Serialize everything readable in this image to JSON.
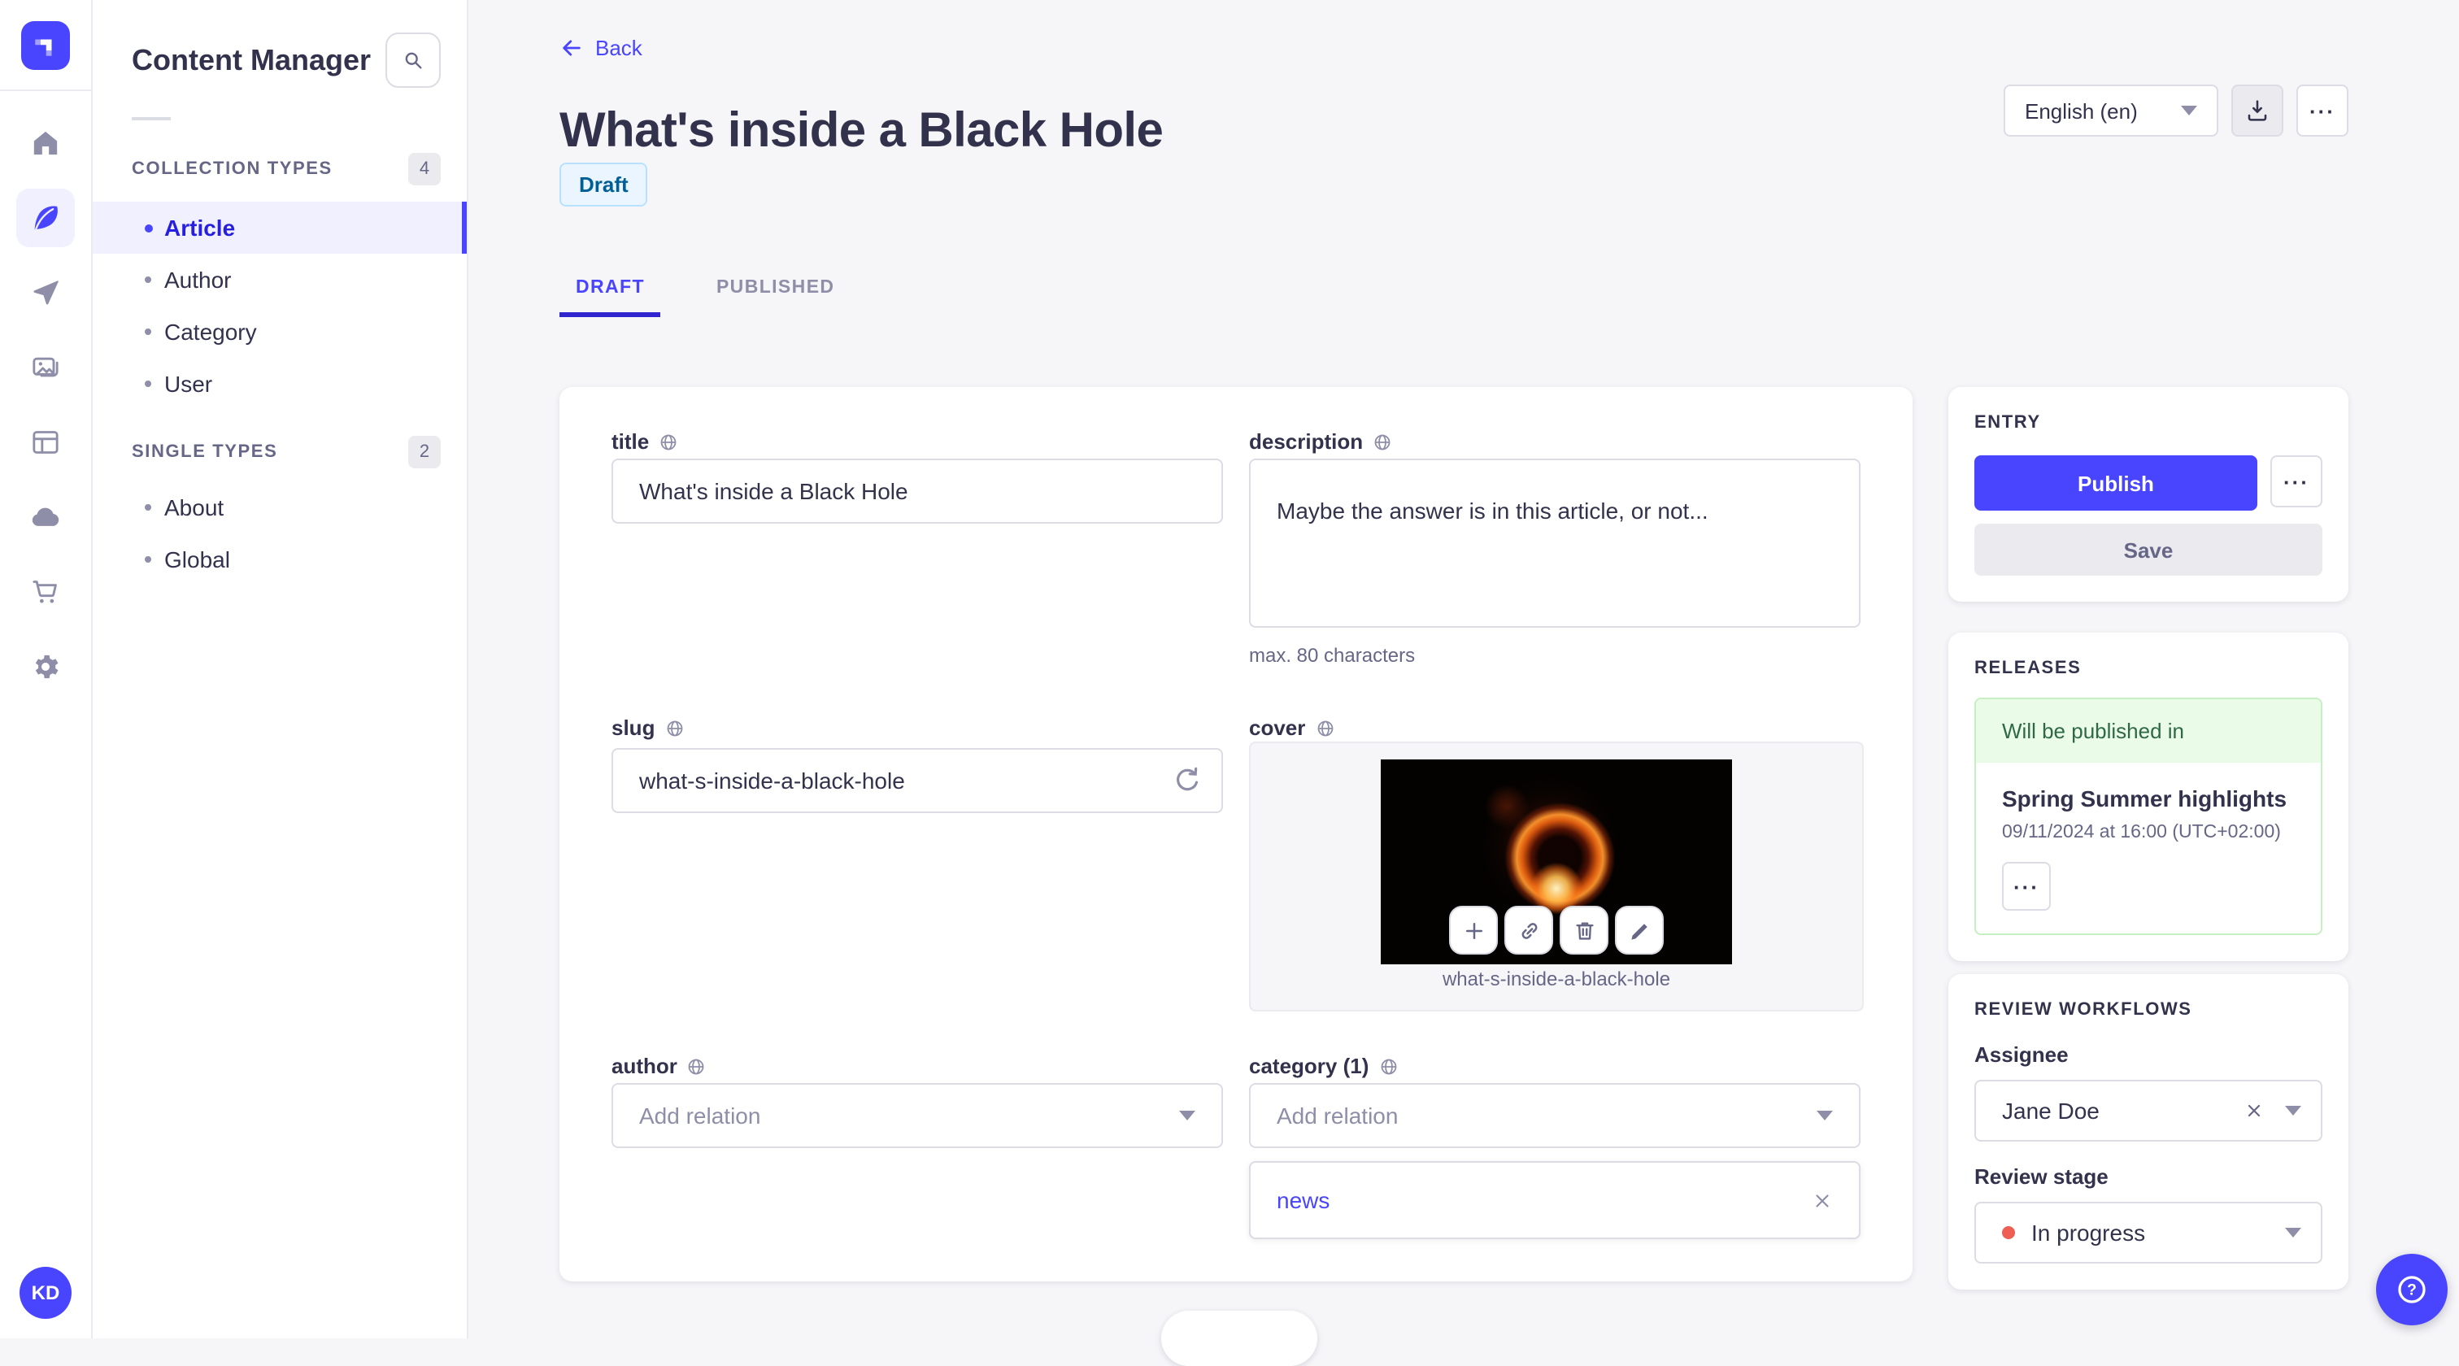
{
  "colors": {
    "accent": "#4945ff",
    "accent_dark": "#271fe0",
    "accent_light": "#f0f0ff",
    "text_dark": "#32324d",
    "text_grey": "#666687",
    "border": "#dcdce4",
    "draft_bg": "#eaf5ff",
    "draft_border": "#b8e1ff",
    "draft_text": "#006096",
    "success_bg": "#eafbe7",
    "success_border": "#c6f0c2",
    "success_text": "#2f6846",
    "danger_dot": "#ee5e52"
  },
  "ui": {
    "ellipsis": "···"
  },
  "rail": {
    "icons": [
      "strapi-logo",
      "home",
      "content-manager-feather",
      "releases-send",
      "media-library-images",
      "content-type-builder-layout",
      "deploy-cloud",
      "marketplace-cart",
      "settings-gear"
    ],
    "avatar_initials": "KD"
  },
  "subsidebar": {
    "title": "Content Manager",
    "sections": [
      {
        "label": "COLLECTION TYPES",
        "count": "4",
        "items": [
          {
            "label": "Article"
          },
          {
            "label": "Author"
          },
          {
            "label": "Category"
          },
          {
            "label": "User"
          }
        ]
      },
      {
        "label": "SINGLE TYPES",
        "count": "2",
        "items": [
          {
            "label": "About"
          },
          {
            "label": "Global"
          }
        ]
      }
    ]
  },
  "header": {
    "back_label": "Back",
    "title": "What's inside a Black Hole",
    "status_badge": "Draft",
    "locale_selected": "English (en)",
    "tabs": [
      {
        "label": "DRAFT"
      },
      {
        "label": "PUBLISHED"
      }
    ]
  },
  "form": {
    "title": {
      "label": "title",
      "value": "What's inside a Black Hole"
    },
    "description": {
      "label": "description",
      "value": "Maybe the answer is in this article, or not...",
      "hint": "max. 80 characters"
    },
    "slug": {
      "label": "slug",
      "value": "what-s-inside-a-black-hole"
    },
    "cover": {
      "label": "cover",
      "caption": "what-s-inside-a-black-hole"
    },
    "author": {
      "label": "author",
      "placeholder": "Add relation"
    },
    "category": {
      "label": "category (1)",
      "placeholder": "Add relation",
      "relation": "news"
    }
  },
  "entry_panel": {
    "header": "ENTRY",
    "publish_label": "Publish",
    "save_label": "Save"
  },
  "releases_panel": {
    "header": "RELEASES",
    "banner": "Will be published in",
    "release_title": "Spring Summer highlights",
    "release_date": "09/11/2024 at 16:00 (UTC+02:00)"
  },
  "review_panel": {
    "header": "REVIEW WORKFLOWS",
    "assignee_label": "Assignee",
    "assignee_value": "Jane Doe",
    "stage_label": "Review stage",
    "stage_value": "In progress"
  }
}
